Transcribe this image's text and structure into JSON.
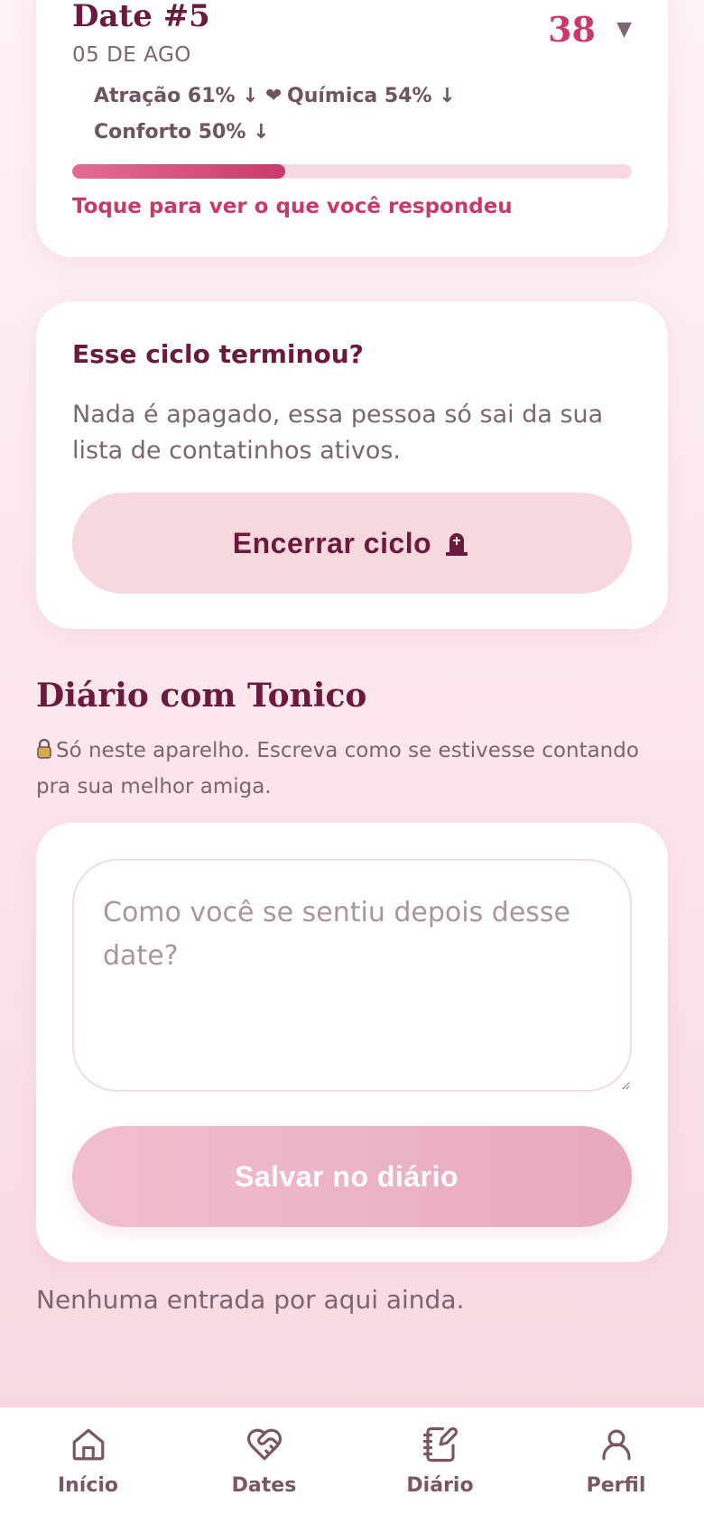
{
  "date_card": {
    "title": "Date #5",
    "date": "05 DE AGO",
    "score": "38",
    "expand_icon": "caret-down-icon",
    "metrics": [
      {
        "icon": "",
        "label": "Atração 61% ↓"
      },
      {
        "icon": "❤",
        "label": "Química 54% ↓"
      },
      {
        "icon": "",
        "label": "Conforto 50% ↓"
      }
    ],
    "progress_percent": 38,
    "tap_hint": "Toque para ver o que você respondeu"
  },
  "cycle_card": {
    "title": "Esse ciclo terminou?",
    "description": "Nada é apagado, essa pessoa só sai da sua lista de contatinhos ativos.",
    "button_label": "Encerrar ciclo",
    "button_icon": "tombstone-icon"
  },
  "diary": {
    "heading": "Diário com Tonico",
    "note_icon": "lock-icon",
    "note": "Só neste aparelho. Escreva como se estivesse contando pra sua melhor amiga.",
    "input_placeholder": "Como você se sentiu depois desse date?",
    "input_value": "",
    "save_label": "Salvar no diário",
    "save_icon": "",
    "empty_message": "Nenhuma entrada por aqui ainda."
  },
  "nav": {
    "items": [
      {
        "label": "Início",
        "icon": "home-icon"
      },
      {
        "label": "Dates",
        "icon": "heart-handshake-icon"
      },
      {
        "label": "Diário",
        "icon": "notebook-pen-icon"
      },
      {
        "label": "Perfil",
        "icon": "user-icon"
      }
    ]
  },
  "colors": {
    "accent": "#c93a6b",
    "heading": "#6b1a3e",
    "body_text": "#7a6570",
    "soft_button": "#f7d8de",
    "save_button": "#e7a9bd",
    "background": "#fbe4ea"
  }
}
